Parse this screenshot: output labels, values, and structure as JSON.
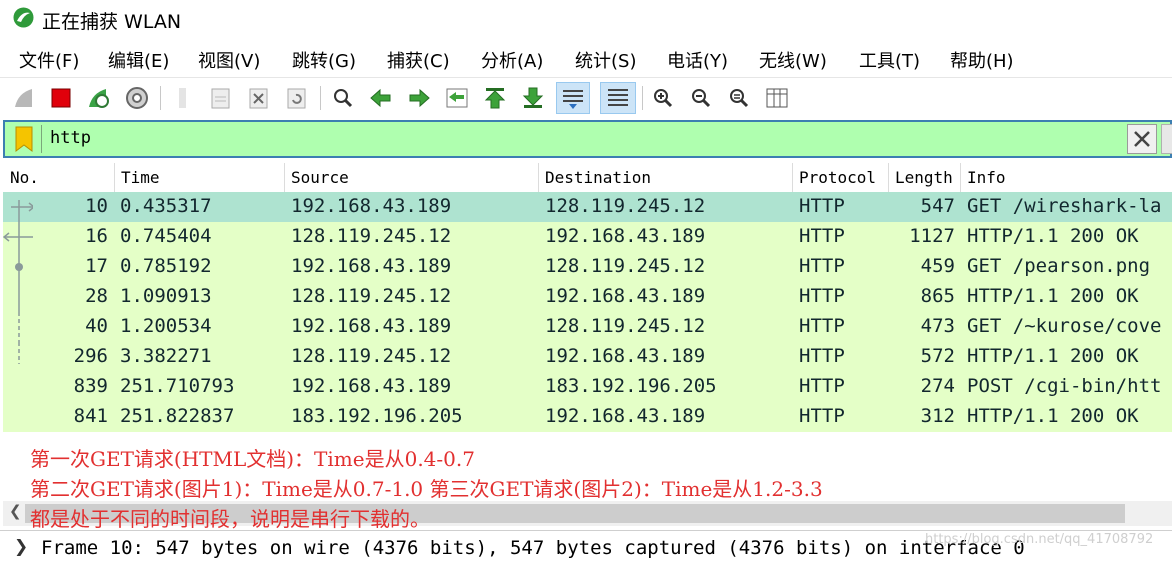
{
  "window": {
    "title": "正在捕获 WLAN"
  },
  "menu": [
    "文件(F)",
    "编辑(E)",
    "视图(V)",
    "跳转(G)",
    "捕获(C)",
    "分析(A)",
    "统计(S)",
    "电话(Y)",
    "无线(W)",
    "工具(T)",
    "帮助(H)"
  ],
  "toolbar": {
    "icons": [
      "start-capture-icon",
      "stop-capture-icon",
      "restart-capture-icon",
      "capture-options-icon",
      "open-file-icon",
      "save-file-icon",
      "close-file-icon",
      "reload-file-icon",
      "find-packet-icon",
      "go-back-icon",
      "go-forward-icon",
      "go-to-packet-icon",
      "go-first-icon",
      "go-last-icon",
      "auto-scroll-icon",
      "colorize-icon",
      "zoom-in-icon",
      "zoom-out-icon",
      "normal-size-icon",
      "resize-columns-icon"
    ]
  },
  "filter": {
    "value": "http"
  },
  "columns": [
    "No.",
    "Time",
    "Source",
    "Destination",
    "Protocol",
    "Length",
    "Info"
  ],
  "packets": [
    {
      "no": "10",
      "time": "0.435317",
      "src": "192.168.43.189",
      "dst": "128.119.245.12",
      "proto": "HTTP",
      "len": "547",
      "info": "GET /wireshark-la"
    },
    {
      "no": "16",
      "time": "0.745404",
      "src": "128.119.245.12",
      "dst": "192.168.43.189",
      "proto": "HTTP",
      "len": "1127",
      "info": "HTTP/1.1 200 OK"
    },
    {
      "no": "17",
      "time": "0.785192",
      "src": "192.168.43.189",
      "dst": "128.119.245.12",
      "proto": "HTTP",
      "len": "459",
      "info": "GET /pearson.png"
    },
    {
      "no": "28",
      "time": "1.090913",
      "src": "128.119.245.12",
      "dst": "192.168.43.189",
      "proto": "HTTP",
      "len": "865",
      "info": "HTTP/1.1 200 OK"
    },
    {
      "no": "40",
      "time": "1.200534",
      "src": "192.168.43.189",
      "dst": "128.119.245.12",
      "proto": "HTTP",
      "len": "473",
      "info": "GET /~kurose/cove"
    },
    {
      "no": "296",
      "time": "3.382271",
      "src": "128.119.245.12",
      "dst": "192.168.43.189",
      "proto": "HTTP",
      "len": "572",
      "info": "HTTP/1.1 200 OK"
    },
    {
      "no": "839",
      "time": "251.710793",
      "src": "192.168.43.189",
      "dst": "183.192.196.205",
      "proto": "HTTP",
      "len": "274",
      "info": "POST /cgi-bin/htt"
    },
    {
      "no": "841",
      "time": "251.822837",
      "src": "183.192.196.205",
      "dst": "192.168.43.189",
      "proto": "HTTP",
      "len": "312",
      "info": "HTTP/1.1 200 OK"
    }
  ],
  "annotations": {
    "line1": "第一次GET请求(HTML文档)：Time是从0.4-0.7",
    "line2": "第二次GET请求(图片1)：Time是从0.7-1.0 第三次GET请求(图片2)：Time是从1.2-3.3",
    "line3": "都是处于不同的时间段，说明是串行下载的。"
  },
  "details": {
    "line": "Frame 10: 547 bytes on wire (4376 bits), 547 bytes captured (4376 bits) on interface 0"
  },
  "watermark": "https://blog.csdn.net/qq_41708792",
  "colors": {
    "row_bg": "#e4ffc7",
    "selected_bg": "#aee3d0",
    "filter_bg": "#afffaf",
    "annotation": "#e23030"
  }
}
